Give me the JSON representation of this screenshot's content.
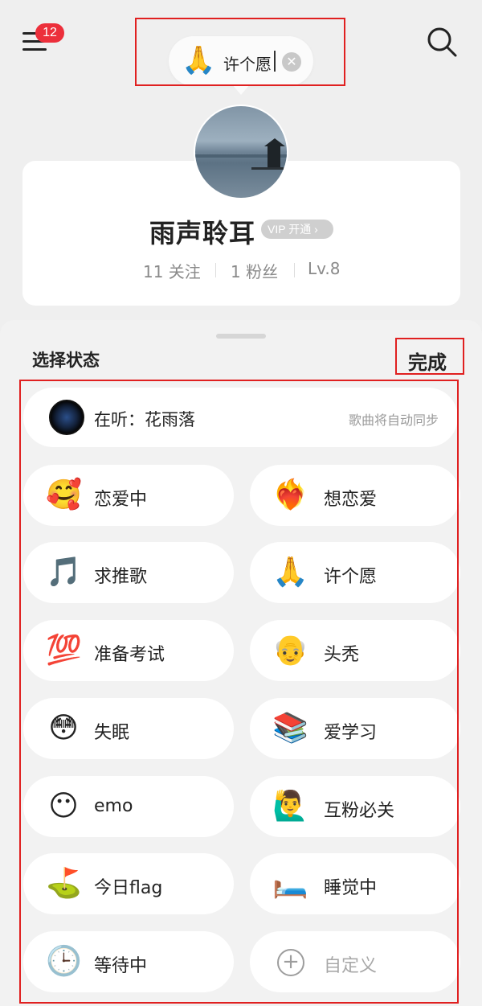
{
  "header": {
    "notification_count": "12",
    "wish_bubble": {
      "emoji": "🙏",
      "text": "许个愿",
      "clear_symbol": "✕"
    }
  },
  "profile": {
    "username": "雨声聆耳",
    "vip_label": "VIP 开通 ›",
    "stats": {
      "following": "11 关注",
      "fans": "1 粉丝",
      "level": "Lv.8"
    }
  },
  "status_sheet": {
    "title": "选择状态",
    "done_label": "完成",
    "listening": {
      "label": "在听：花雨落",
      "hint": "歌曲将自动同步"
    },
    "statuses": [
      {
        "emoji": "🥰",
        "label": "恋爱中"
      },
      {
        "emoji": "❤️‍🔥",
        "label": "想恋爱"
      },
      {
        "emoji": "🎵",
        "label": "求推歌"
      },
      {
        "emoji": "🙏",
        "label": "许个愿"
      },
      {
        "emoji": "💯",
        "label": "准备考试"
      },
      {
        "emoji": "👴",
        "label": "头秃"
      },
      {
        "emoji": "😳",
        "label": "失眠"
      },
      {
        "emoji": "📚",
        "label": "爱学习"
      },
      {
        "emoji": "😶",
        "label": "emo"
      },
      {
        "emoji": "🙋‍♂️",
        "label": "互粉必关"
      },
      {
        "emoji": "⛳",
        "label": "今日flag"
      },
      {
        "emoji": "🛏️",
        "label": "睡觉中"
      },
      {
        "emoji": "🕒",
        "label": "等待中"
      },
      {
        "emoji": "plus-icon",
        "label": "自定义"
      }
    ]
  },
  "colors": {
    "accent": "#ec2f3b",
    "highlight_frame": "#e02020"
  }
}
